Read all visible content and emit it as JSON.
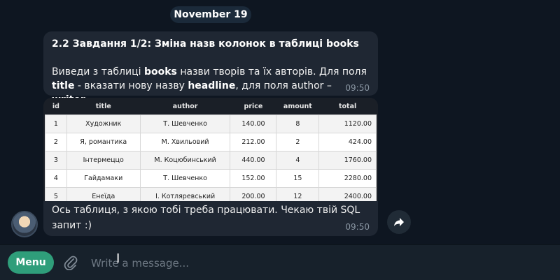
{
  "date": "November 19",
  "message1": {
    "title": "2.2 Завдання 1/2: Зміна назв колонок в таблиці books",
    "body_part1": "Виведи з таблиці ",
    "body_bold1": "books",
    "body_part2": " назви творів та їх авторів. Для поля ",
    "body_bold2": "title",
    "body_part3": " - вказати нову назву ",
    "body_bold3": "headline",
    "body_part4": ", для поля author – ",
    "body_bold4": "writer",
    "body_part5": ".",
    "time": "09:50"
  },
  "table": {
    "headers": [
      "id",
      "title",
      "author",
      "price",
      "amount",
      "total"
    ],
    "rows": [
      [
        "1",
        "Художник",
        "Т. Шевченко",
        "140.00",
        "8",
        "1120.00"
      ],
      [
        "2",
        "Я, романтика",
        "М. Хвильовий",
        "212.00",
        "2",
        "424.00"
      ],
      [
        "3",
        "Інтермеццо",
        "М. Коцюбинський",
        "440.00",
        "4",
        "1760.00"
      ],
      [
        "4",
        "Гайдамаки",
        "Т. Шевченко",
        "152.00",
        "15",
        "2280.00"
      ],
      [
        "5",
        "Енеїда",
        "І. Котляревський",
        "200.00",
        "12",
        "2400.00"
      ]
    ]
  },
  "message2": {
    "caption": "Ось таблиця, з якою тобі треба працювати. Чекаю твій SQL запит :)",
    "time": "09:50"
  },
  "bottom_bar": {
    "menu_label": "Menu",
    "input_placeholder": "Write a message..."
  },
  "icons": {
    "attach": "paperclip-icon",
    "share": "share-icon",
    "avatar": "bot-avatar"
  },
  "colors": {
    "background": "#0e1621",
    "bubble": "#1f2733",
    "accent": "#2f9e7a"
  }
}
